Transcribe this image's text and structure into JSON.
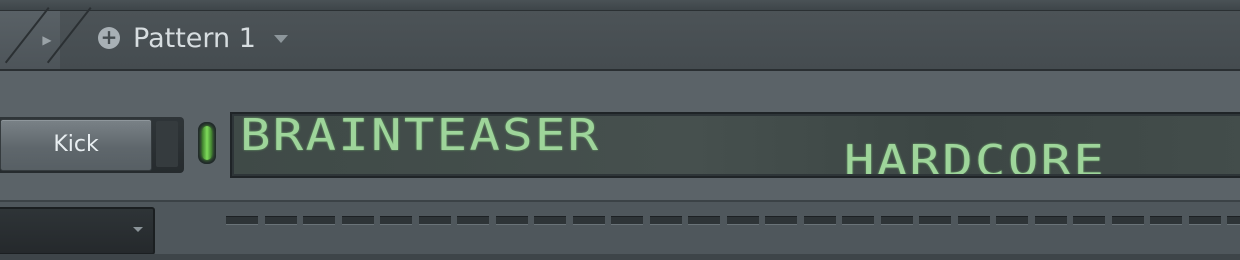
{
  "toolbar": {
    "arrow_glyph": "▶",
    "pattern_add_glyph": "+",
    "pattern_name": "Pattern 1"
  },
  "channel": {
    "name": "Kick",
    "display_line1": "BRAINTEASER",
    "display_line2": "HARDCORE",
    "led_color": "#7edc5a",
    "display_text_color": "#9ed59a"
  },
  "steps": {
    "count": 27
  }
}
